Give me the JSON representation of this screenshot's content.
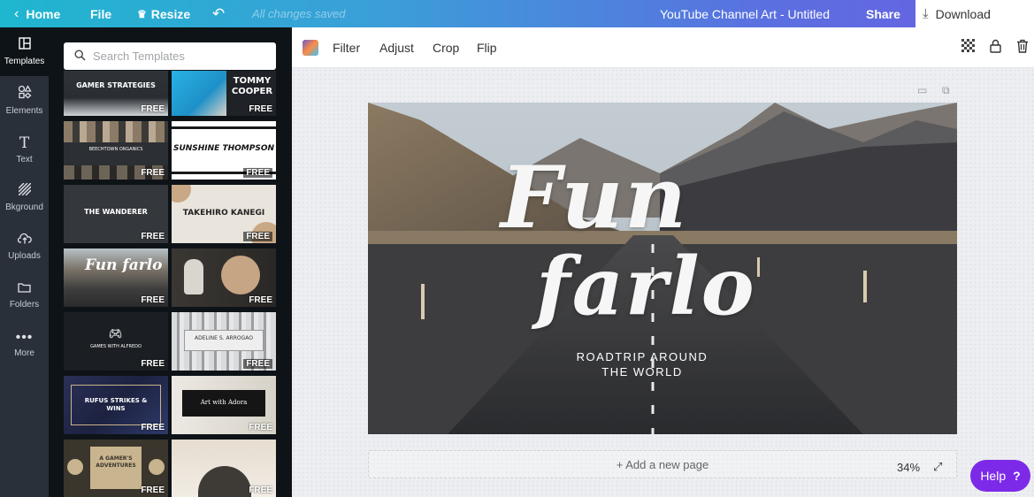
{
  "topbar": {
    "home": "Home",
    "file": "File",
    "resize": "Resize",
    "saved": "All changes saved",
    "title": "YouTube Channel Art - Untitled",
    "share": "Share",
    "download": "Download"
  },
  "rail": [
    {
      "label": "Templates",
      "icon": "templates-icon"
    },
    {
      "label": "Elements",
      "icon": "elements-icon"
    },
    {
      "label": "Text",
      "icon": "text-icon"
    },
    {
      "label": "Bkground",
      "icon": "background-icon"
    },
    {
      "label": "Uploads",
      "icon": "uploads-icon"
    },
    {
      "label": "Folders",
      "icon": "folders-icon"
    },
    {
      "label": "More",
      "icon": "more-icon"
    }
  ],
  "search": {
    "placeholder": "Search Templates"
  },
  "templates": [
    {
      "title": "GAMER STRATEGIES",
      "badge": "FREE"
    },
    {
      "title": "TOMMY COOPER",
      "badge": "FREE"
    },
    {
      "title": "BEECHTOWN ORGANICS",
      "badge": "FREE"
    },
    {
      "title": "SUNSHINE THOMPSON",
      "badge": "FREE"
    },
    {
      "title": "THE WANDERER",
      "badge": "FREE"
    },
    {
      "title": "TAKEHIRO KANEGI",
      "badge": "FREE"
    },
    {
      "title": "Fun farlo",
      "badge": "FREE"
    },
    {
      "title": "",
      "badge": "FREE"
    },
    {
      "title": "GAMES WITH ALFREDO",
      "badge": "FREE"
    },
    {
      "title": "ADELINE S. ARROGAO",
      "badge": "FREE"
    },
    {
      "title": "RUFUS STRIKES & WINS",
      "badge": "FREE"
    },
    {
      "title": "Art with Adora",
      "badge": "FREE"
    },
    {
      "title": "A GAMER'S ADVENTURES",
      "badge": "FREE"
    },
    {
      "title": "",
      "badge": "FREE"
    }
  ],
  "toolbar": {
    "filter": "Filter",
    "adjust": "Adjust",
    "crop": "Crop",
    "flip": "Flip"
  },
  "canvas": {
    "title_line1": "Fun",
    "title_line2": "farlo",
    "subtitle_line1": "ROADTRIP AROUND",
    "subtitle_line2": "THE WORLD"
  },
  "add_page": "+ Add a new page",
  "zoom": "34%",
  "help": "Help"
}
